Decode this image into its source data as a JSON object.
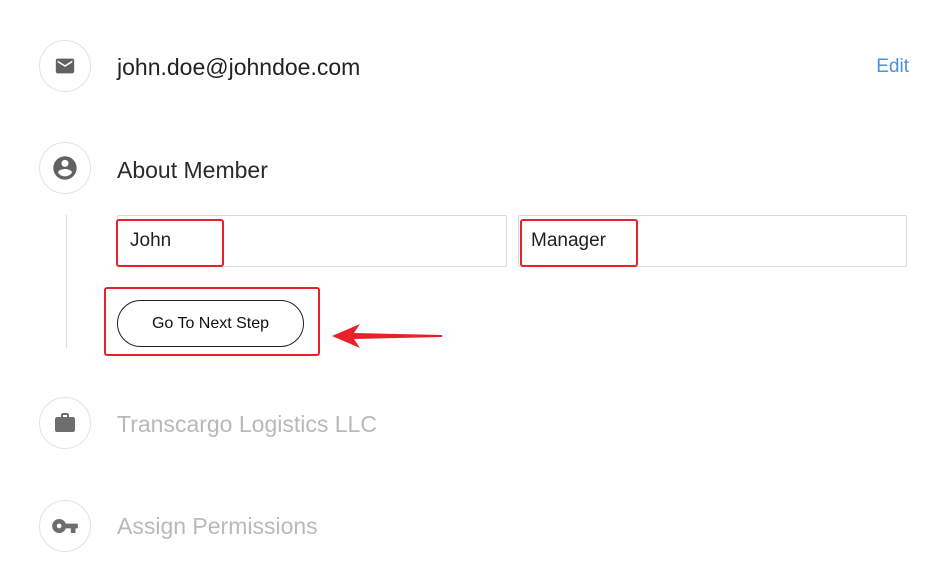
{
  "email_step": {
    "icon": "email-icon",
    "email": "john.doe@johndoe.com",
    "edit_label": "Edit"
  },
  "about_step": {
    "icon": "person-circle-icon",
    "title": "About Member",
    "first_name_value": "John",
    "role_value": "Manager",
    "next_button_label": "Go To Next Step"
  },
  "company_step": {
    "icon": "briefcase-icon",
    "title": "Transcargo Logistics LLC"
  },
  "permissions_step": {
    "icon": "key-icon",
    "title": "Assign Permissions"
  },
  "colors": {
    "accent_link": "#4a90e2",
    "annotation_red": "#e8202a",
    "icon_active": "#616161",
    "icon_inactive": "#6e6e6e",
    "muted_text": "#b9b9b9"
  }
}
